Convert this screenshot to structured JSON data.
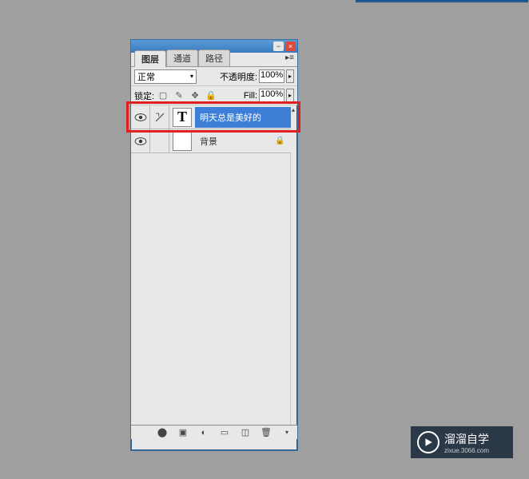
{
  "tabs": {
    "layers": "图层",
    "channels": "通道",
    "paths": "路径"
  },
  "blend_mode": "正常",
  "opacity": {
    "label": "不透明度:",
    "value": "100%"
  },
  "lock": {
    "label": "锁定:"
  },
  "fill": {
    "label": "Fill:",
    "value": "100%"
  },
  "layers": [
    {
      "name": "明天总是美好的",
      "type": "T",
      "selected": true,
      "locked": false
    },
    {
      "name": "背景",
      "type": "bg",
      "selected": false,
      "locked": true
    }
  ],
  "watermark": {
    "text": "溜溜自学",
    "sub": "zixue.3066.com"
  }
}
